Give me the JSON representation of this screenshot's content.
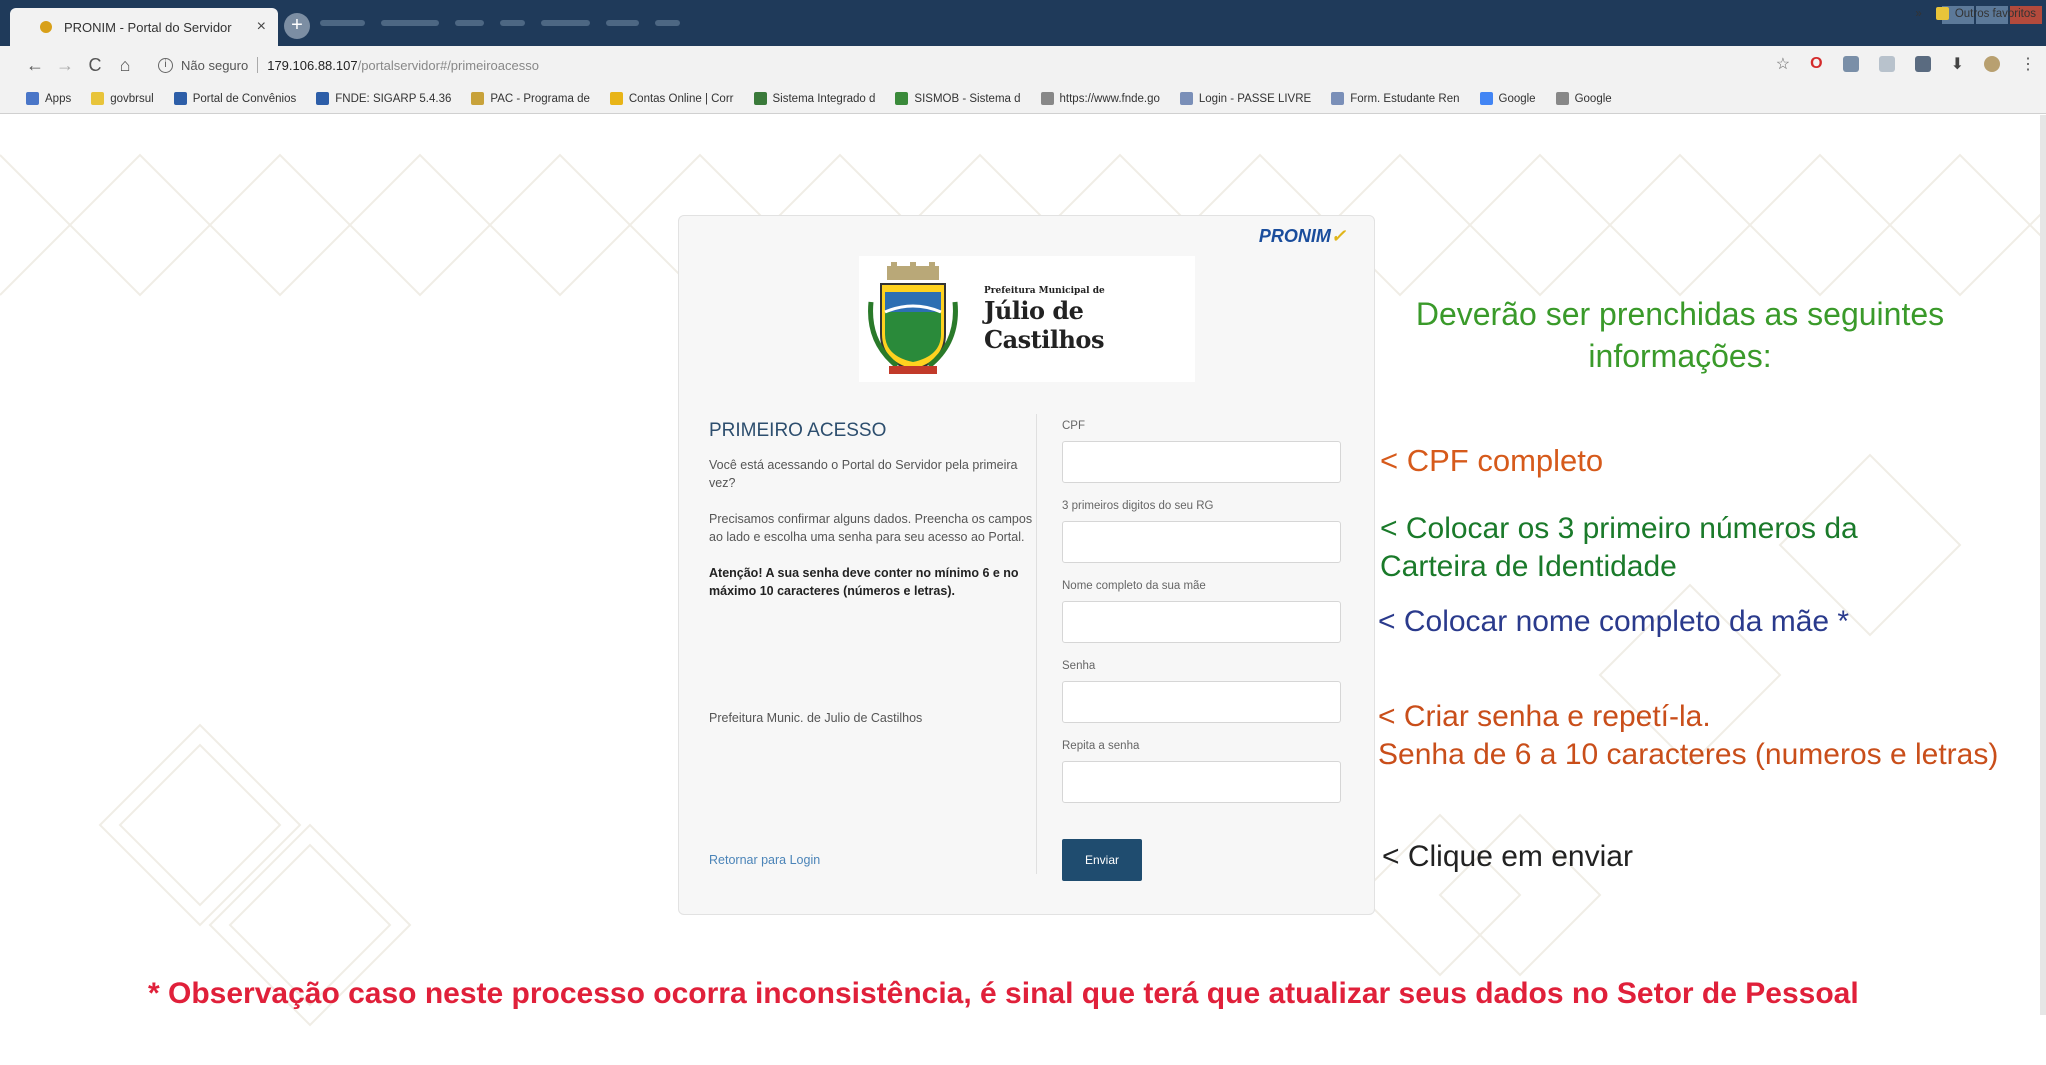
{
  "browser": {
    "tab_title": "PRONIM - Portal do Servidor",
    "tab_close": "×",
    "new_tab": "+",
    "not_secure": "Não seguro",
    "url_host": "179.106.88.107",
    "url_path": "/portalservidor#/primeiroacesso",
    "bookmarks": [
      {
        "label": "Apps",
        "color": "#4a76c8"
      },
      {
        "label": "govbrsul",
        "color": "#e8c43a"
      },
      {
        "label": "Portal de Convênios",
        "color": "#2d5ea8"
      },
      {
        "label": "FNDE: SIGARP 5.4.36",
        "color": "#2d5ea8"
      },
      {
        "label": "PAC - Programa de",
        "color": "#c8a23a"
      },
      {
        "label": "Contas Online | Corr",
        "color": "#e8b417"
      },
      {
        "label": "Sistema Integrado d",
        "color": "#3a7a3a"
      },
      {
        "label": "SISMOB - Sistema d",
        "color": "#3a8a3a"
      },
      {
        "label": "https://www.fnde.go",
        "color": "#888888"
      },
      {
        "label": "Login - PASSE LIVRE",
        "color": "#7a8fb8"
      },
      {
        "label": "Form. Estudante Ren",
        "color": "#7a8fb8"
      },
      {
        "label": "Google",
        "color": "#4285f4"
      },
      {
        "label": "Google",
        "color": "#888888"
      }
    ],
    "bookmarks_more": "»",
    "other_bookmarks": "Outros favoritos"
  },
  "card": {
    "brand": "PRONIM",
    "logo_small": "Prefeitura Municipal de",
    "logo_big": "Júlio de Castilhos",
    "heading": "PRIMEIRO ACESSO",
    "p1": "Você está acessando o Portal do Servidor pela primeira vez?",
    "p2": "Precisamos confirmar alguns dados. Preencha os campos ao lado e escolha uma senha para seu acesso ao Portal.",
    "p3": "Atenção! A sua senha deve conter no mínimo 6 e no máximo 10 caracteres (números e letras).",
    "prefeitura": "Prefeitura Munic. de Julio de Castilhos",
    "back_link": "Retornar para Login",
    "fields": {
      "cpf": "CPF",
      "rg": "3 primeiros digitos do seu RG",
      "mae": "Nome completo da sua mãe",
      "senha": "Senha",
      "repita": "Repita a senha"
    },
    "submit": "Enviar"
  },
  "annotations": {
    "heading_line1": "Deverão ser prenchidas as seguintes",
    "heading_line2": "informações:",
    "cpf": "< CPF completo",
    "rg_line1": "< Colocar os 3 primeiro números da",
    "rg_line2": "Carteira de Identidade",
    "mae": "< Colocar nome completo da mãe *",
    "senha_line1": "< Criar senha e repetí-la.",
    "senha_line2": "Senha de 6 a 10 caracteres (numeros e letras)",
    "enviar": "< Clique em enviar",
    "observacao": "* Observação caso neste processo ocorra inconsistência, é  sinal que terá que atualizar seus dados no Setor de Pessoal"
  }
}
